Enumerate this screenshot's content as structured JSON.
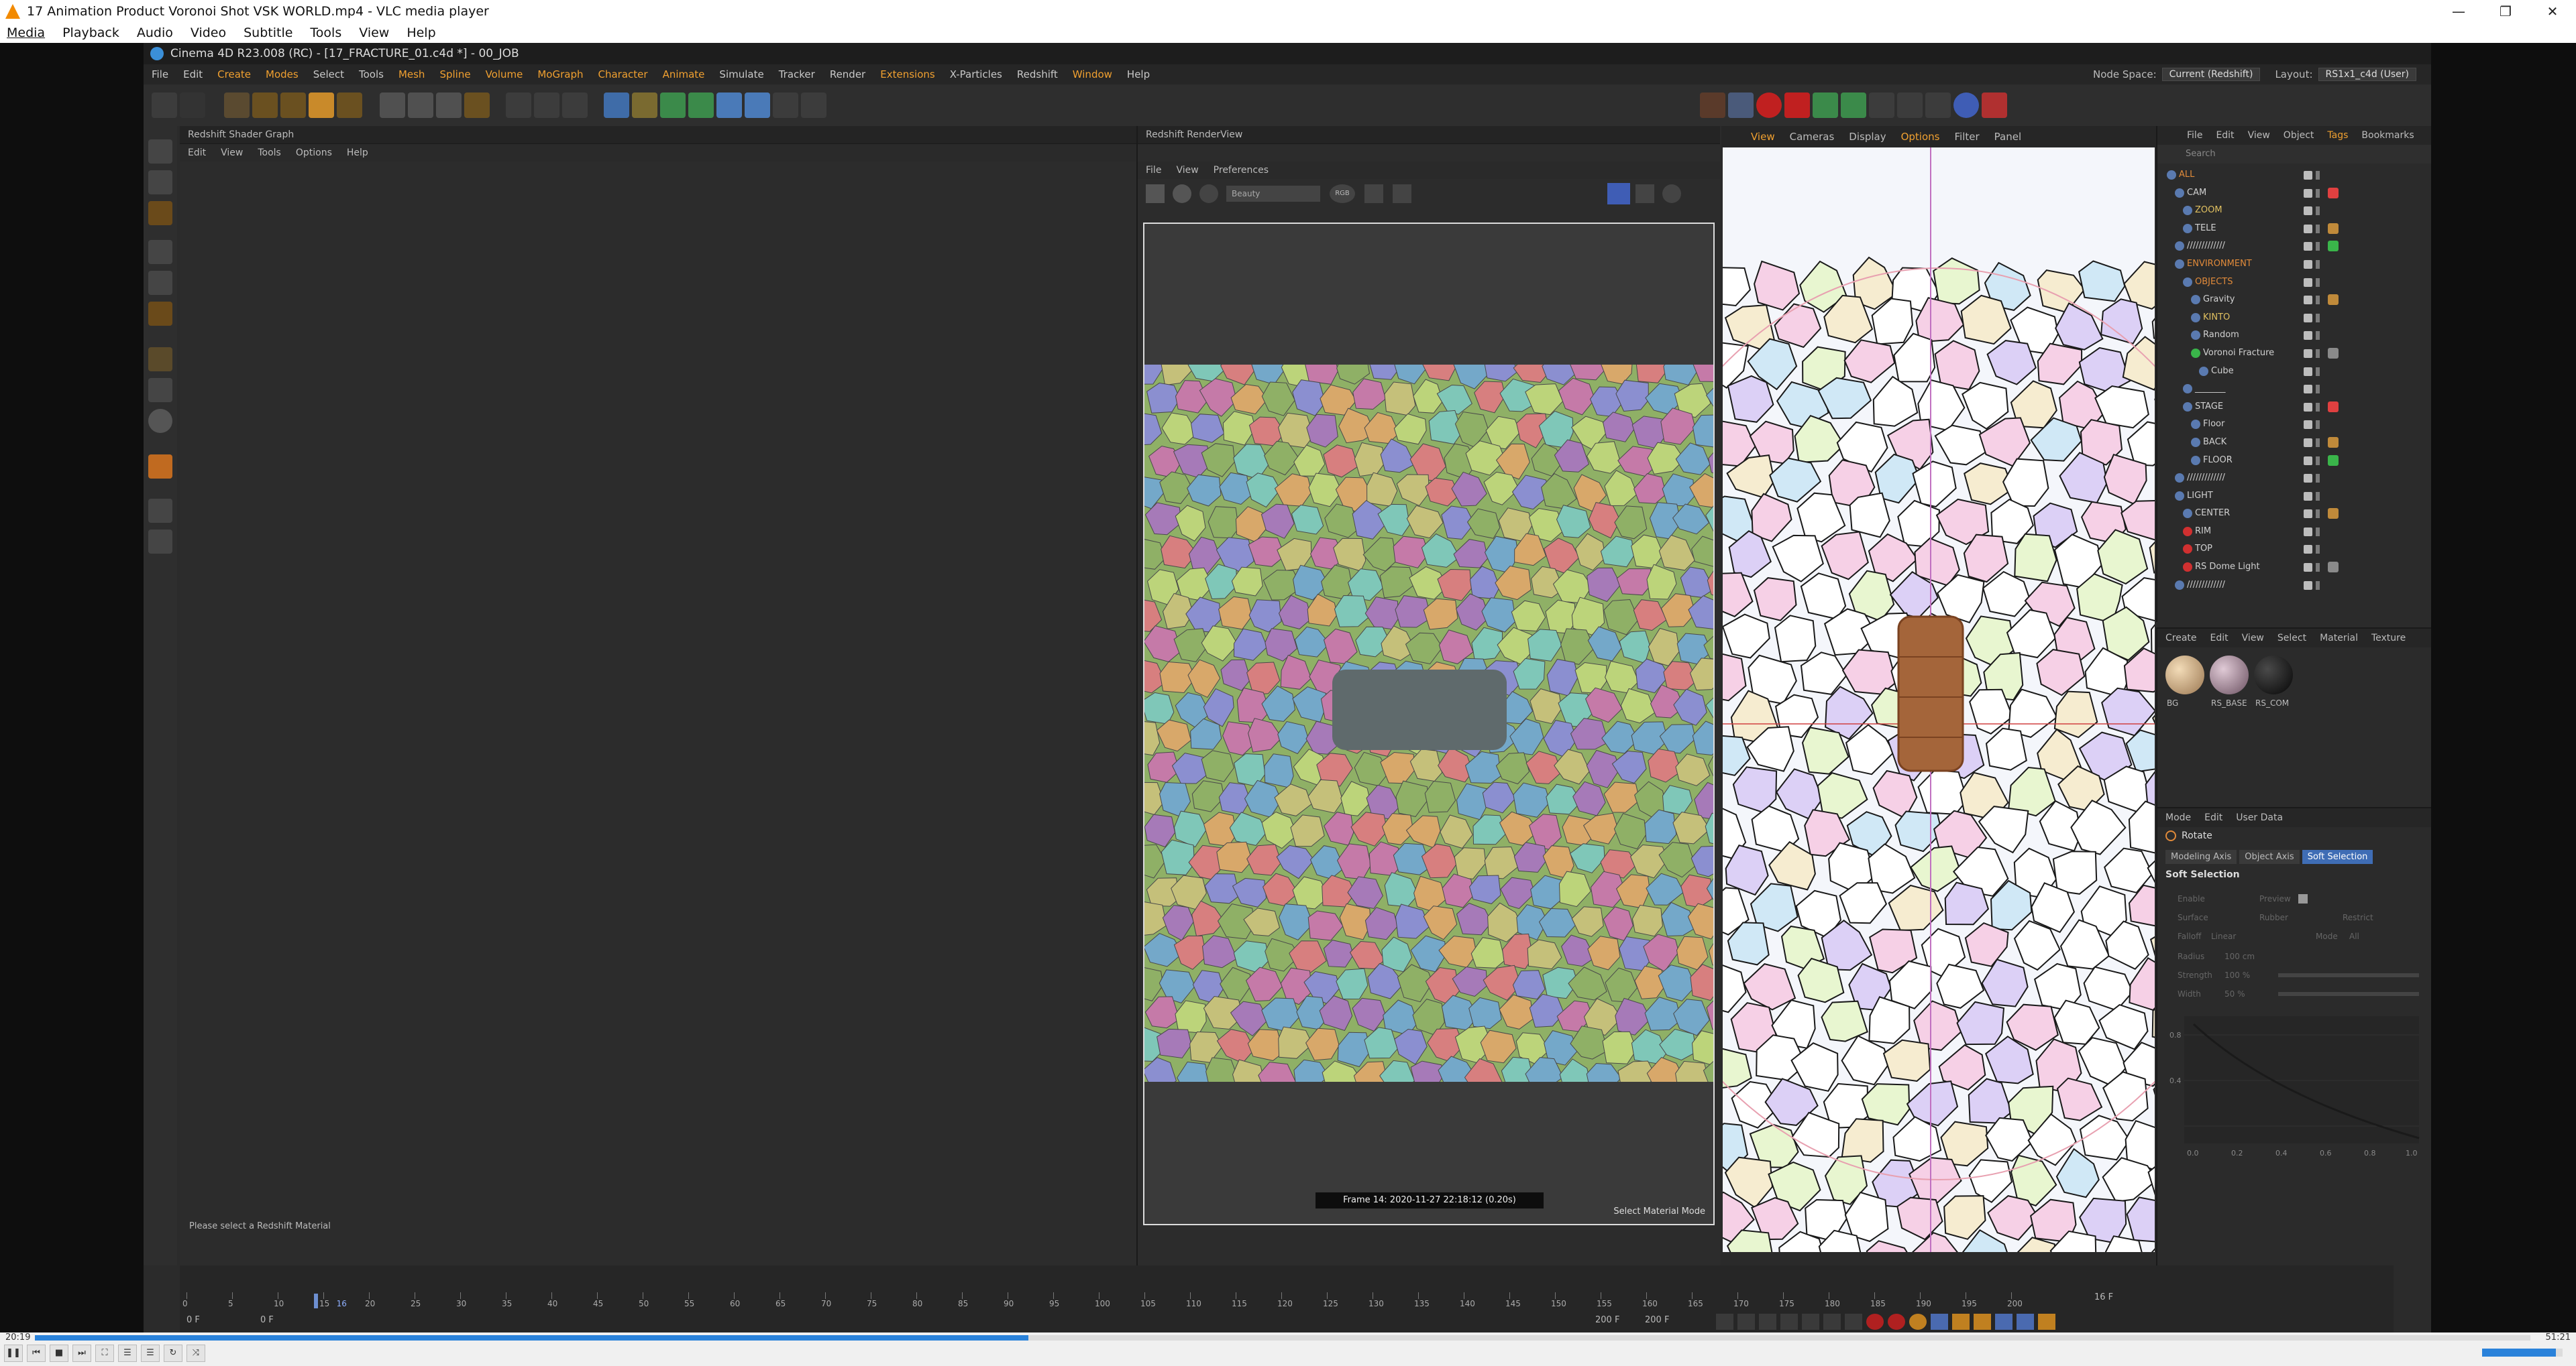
{
  "vlc": {
    "title": "17 Animation Product Voronoi Shot VSK WORLD.mp4 - VLC media player",
    "menu": [
      "Media",
      "Playback",
      "Audio",
      "Video",
      "Subtitle",
      "Tools",
      "View",
      "Help"
    ],
    "time_elapsed": "20:19",
    "time_total": "51:21",
    "progress": 0.398,
    "volume": 0.92
  },
  "c4d": {
    "title": "Cinema 4D R23.008 (RC) - [17_FRACTURE_01.c4d *] - 00_JOB",
    "menu": [
      "File",
      "Edit",
      "Create",
      "Modes",
      "Select",
      "Tools",
      "Mesh",
      "Spline",
      "Volume",
      "MoGraph",
      "Character",
      "Animate",
      "Simulate",
      "Tracker",
      "Render",
      "Extensions",
      "X-Particles",
      "Redshift",
      "Window",
      "Help"
    ],
    "node_space_label": "Node Space:",
    "node_space_value": "Current (Redshift)",
    "layout_label": "Layout:",
    "layout_value": "RS1x1_c4d (User)"
  },
  "shader_graph": {
    "title": "Redshift Shader Graph",
    "menu": [
      "Edit",
      "View",
      "Tools",
      "Options",
      "Help"
    ],
    "status": "Please select a Redshift Material"
  },
  "render_view": {
    "title": "Redshift RenderView",
    "menu": [
      "File",
      "View",
      "Preferences"
    ],
    "aov": "Beauty",
    "channel": "RGB",
    "frame_info": "Frame 14:  2020-11-27  22:18:12  (0.20s)",
    "mode_hint": "Select Material Mode"
  },
  "viewport": {
    "menu": [
      "View",
      "Cameras",
      "Display",
      "Options",
      "Filter",
      "Panel"
    ]
  },
  "object_manager": {
    "menu": [
      "File",
      "Edit",
      "View",
      "Object",
      "Tags",
      "Bookmarks"
    ],
    "search_placeholder": "Search",
    "objects": [
      {
        "name": "ALL",
        "depth": 0,
        "color": "#e08a3a"
      },
      {
        "name": "CAM",
        "depth": 1,
        "color": "#d0d0d0"
      },
      {
        "name": "ZOOM",
        "depth": 2,
        "color": "#e0c060"
      },
      {
        "name": "TELE",
        "depth": 2,
        "color": "#d0d0d0"
      },
      {
        "name": "/////////////",
        "depth": 1,
        "color": "#d0d0d0"
      },
      {
        "name": "ENVIRONMENT",
        "depth": 1,
        "color": "#e08a3a"
      },
      {
        "name": "OBJECTS",
        "depth": 2,
        "color": "#e08a3a"
      },
      {
        "name": "Gravity",
        "depth": 3,
        "color": "#d0d0d0"
      },
      {
        "name": "KINTO",
        "depth": 3,
        "color": "#e0c060"
      },
      {
        "name": "Random",
        "depth": 3,
        "color": "#d0d0d0"
      },
      {
        "name": "Voronoi Fracture",
        "depth": 3,
        "color": "#d0d0d0"
      },
      {
        "name": "Cube",
        "depth": 4,
        "color": "#d0d0d0"
      },
      {
        "name": "_______",
        "depth": 2,
        "color": "#d0d0d0"
      },
      {
        "name": "STAGE",
        "depth": 2,
        "color": "#d0d0d0"
      },
      {
        "name": "Floor",
        "depth": 3,
        "color": "#d0d0d0"
      },
      {
        "name": "BACK",
        "depth": 3,
        "color": "#d0d0d0"
      },
      {
        "name": "FLOOR",
        "depth": 3,
        "color": "#d0d0d0"
      },
      {
        "name": "/////////////",
        "depth": 1,
        "color": "#d0d0d0"
      },
      {
        "name": "LIGHT",
        "depth": 1,
        "color": "#d0d0d0"
      },
      {
        "name": "CENTER",
        "depth": 2,
        "color": "#d0d0d0"
      },
      {
        "name": "RIM",
        "depth": 2,
        "color": "#d0d0d0"
      },
      {
        "name": "TOP",
        "depth": 2,
        "color": "#d0d0d0"
      },
      {
        "name": "RS Dome Light",
        "depth": 2,
        "color": "#d0d0d0"
      },
      {
        "name": "/////////////",
        "depth": 1,
        "color": "#d0d0d0"
      }
    ]
  },
  "material_manager": {
    "menu": [
      "Create",
      "Edit",
      "View",
      "Select",
      "Material",
      "Texture"
    ],
    "materials": [
      {
        "name": "BG",
        "color": "#d8b88a"
      },
      {
        "name": "RS_BASE",
        "color": "#b59aa8"
      },
      {
        "name": "RS_COM",
        "color": "#1a1a1a"
      }
    ]
  },
  "attributes": {
    "menu": [
      "Mode",
      "Edit",
      "User Data"
    ],
    "tool": "Rotate",
    "tabs": [
      "Modeling Axis",
      "Object Axis",
      "Soft Selection"
    ],
    "active_tab": "Soft Selection",
    "section": "Soft Selection",
    "params": {
      "enable": "Enable",
      "preview": "Preview",
      "surface": "Surface",
      "rubber": "Rubber",
      "restrict": "Restrict",
      "falloff": "Falloff",
      "falloff_value": "Linear",
      "mode": "Mode",
      "mode_value": "All",
      "radius": "Radius",
      "radius_value": "100 cm",
      "strength": "Strength",
      "strength_value": "100 %",
      "width": "Width",
      "width_value": "50 %"
    },
    "graph_y_labels": [
      "0.8",
      "0.4"
    ],
    "graph_x_labels": [
      "0.0",
      "0.2",
      "0.4",
      "0.6",
      "0.8",
      "1.0"
    ]
  },
  "timeline": {
    "ticks": [
      "0",
      "5",
      "10",
      "15",
      "16",
      "20",
      "25",
      "30",
      "35",
      "40",
      "45",
      "50",
      "55",
      "60",
      "65",
      "70",
      "75",
      "80",
      "85",
      "90",
      "95",
      "100",
      "105",
      "110",
      "115",
      "120",
      "125",
      "130",
      "135",
      "140",
      "145",
      "150",
      "155",
      "160",
      "165",
      "170",
      "175",
      "180",
      "185",
      "190",
      "195",
      "200"
    ],
    "current_frame": "16 F",
    "start_frame": "0 F",
    "min_frame": "0 F",
    "max_frame": "200 F",
    "end_frame": "200 F"
  }
}
